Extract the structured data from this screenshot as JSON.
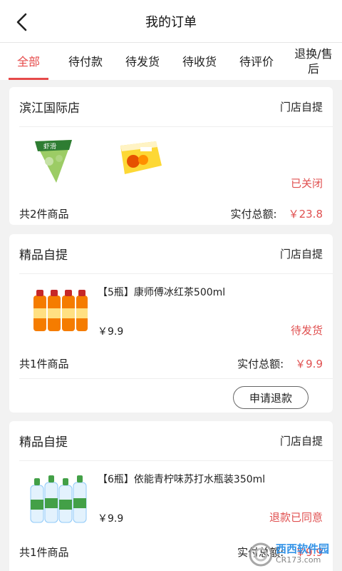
{
  "header": {
    "title": "我的订单"
  },
  "tabs": [
    {
      "label": "全部",
      "active": true
    },
    {
      "label": "待付款",
      "active": false
    },
    {
      "label": "待发货",
      "active": false
    },
    {
      "label": "待收货",
      "active": false
    },
    {
      "label": "待评价",
      "active": false
    },
    {
      "label": "退换/售后",
      "active": false
    }
  ],
  "orders": [
    {
      "store": "滨江国际店",
      "pickup": "门店自提",
      "status": "已关闭",
      "count": "共2件商品",
      "total_label": "实付总额:",
      "total": "￥23.8"
    },
    {
      "store": "精品自提",
      "pickup": "门店自提",
      "product": "【5瓶】康师傅冰红茶500ml",
      "price": "￥9.9",
      "status": "待发货",
      "count": "共1件商品",
      "total_label": "实付总额:",
      "total": "￥9.9",
      "action": "申请退款"
    },
    {
      "store": "精品自提",
      "pickup": "门店自提",
      "product": "【6瓶】依能青柠味苏打水瓶装350ml",
      "price": "￥9.9",
      "status": "退款已同意",
      "count": "共1件商品",
      "total_label": "实付总额:",
      "total": "￥9.9"
    }
  ],
  "watermark": {
    "brand": "西西软件园",
    "domain": "CR173.com"
  },
  "colors": {
    "accent": "#e64a4a",
    "status": "#e05050",
    "background": "#f2f2f2"
  },
  "icons": {
    "back": "chevron-left-icon"
  }
}
